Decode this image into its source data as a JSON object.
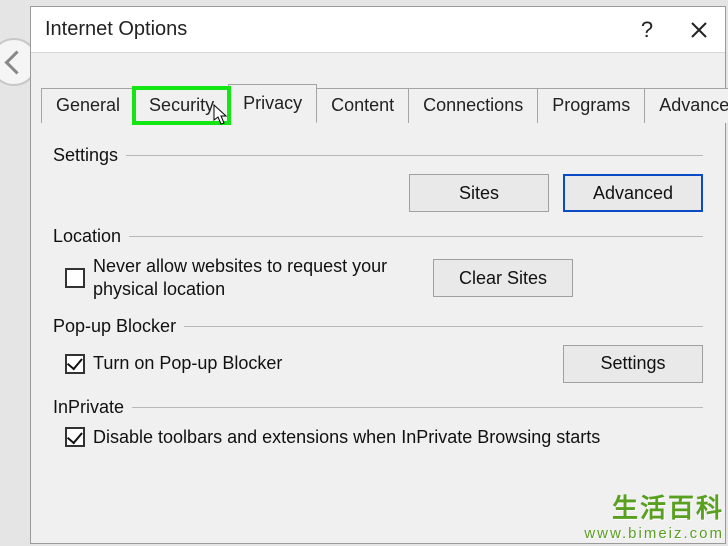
{
  "dialog": {
    "title": "Internet Options"
  },
  "tabs": {
    "general": "General",
    "security": "Security",
    "privacy": "Privacy",
    "content": "Content",
    "connections": "Connections",
    "programs": "Programs",
    "advanced": "Advanced"
  },
  "settings": {
    "header": "Settings",
    "sites_btn": "Sites",
    "advanced_btn": "Advanced"
  },
  "location": {
    "header": "Location",
    "never_allow": "Never allow websites to request your physical location",
    "never_allow_checked": false,
    "clear_sites_btn": "Clear Sites"
  },
  "popup": {
    "header": "Pop-up Blocker",
    "turn_on": "Turn on Pop-up Blocker",
    "turn_on_checked": true,
    "settings_btn": "Settings"
  },
  "inprivate": {
    "header": "InPrivate",
    "disable_toolbars": "Disable toolbars and extensions when InPrivate Browsing starts",
    "disable_toolbars_checked": true
  },
  "watermark": {
    "top": "生活百科",
    "url": "www.bimeiz.com"
  }
}
